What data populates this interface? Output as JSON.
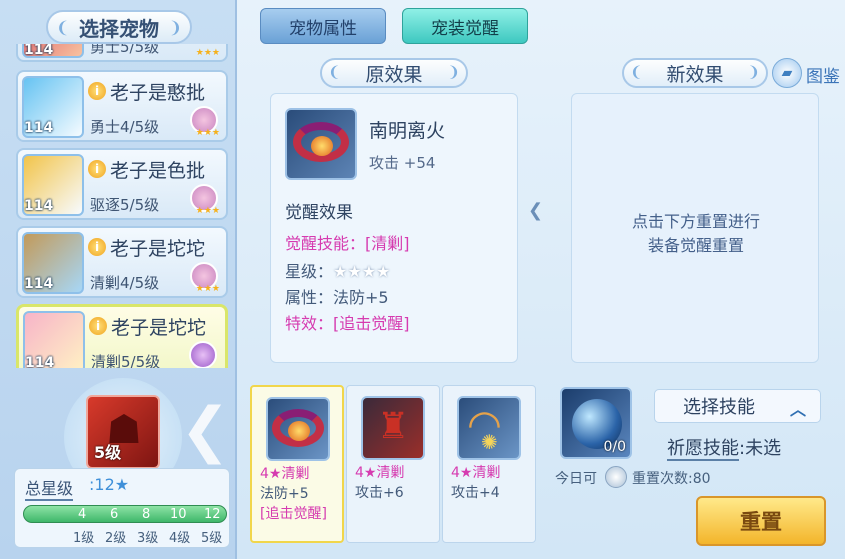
{
  "left": {
    "title": "选择宠物",
    "pets": [
      {
        "level": "114",
        "name": "",
        "rank": "勇士5/5级",
        "active": false
      },
      {
        "level": "114",
        "name": "老子是憨批",
        "rank": "勇士4/5级",
        "active": false
      },
      {
        "level": "114",
        "name": "老子是色批",
        "rank": "驱逐5/5级",
        "active": false
      },
      {
        "level": "114",
        "name": "老子是坨坨",
        "rank": "清剿4/5级",
        "active": false
      },
      {
        "level": "114",
        "name": "老子是坨坨",
        "rank": "清剿5/5级",
        "active": true
      }
    ],
    "skill_level": "5级",
    "total_star_label": "总星级",
    "total_star_value": ":12★",
    "star_ticks": [
      "4",
      "6",
      "8",
      "10",
      "12"
    ],
    "level_labels": [
      "1级",
      "2级",
      "3级",
      "4级",
      "5级"
    ]
  },
  "tabs": {
    "pet_attr": "宠物属性",
    "awaken": "宠装觉醒"
  },
  "old": {
    "header": "原效果",
    "item_name": "南明离火",
    "item_stat": "攻击 +54",
    "awaken_title": "觉醒效果",
    "skill_label": "觉醒技能：",
    "skill_value": "[清剿]",
    "star_label": "星级：",
    "star_value": "★★★★",
    "attr_label": "属性：",
    "attr_value": "法防+5",
    "effect_label": "特效：",
    "effect_value": "[追击觉醒]"
  },
  "new": {
    "header": "新效果",
    "atlas": "图鉴",
    "line1": "点击下方重置进行",
    "line2": "装备觉醒重置"
  },
  "equipment": [
    {
      "stars": "4★清剿",
      "stat": "法防+5",
      "extra": "[追击觉醒]",
      "active": true
    },
    {
      "stars": "4★清剿",
      "stat": "攻击+6",
      "extra": "",
      "active": false
    },
    {
      "stars": "4★清剿",
      "stat": "攻击+4",
      "extra": "",
      "active": false
    }
  ],
  "orb": {
    "count": "0/0"
  },
  "today_label": "今日可",
  "reset_count": "重置次数:80",
  "choose_skill": "选择技能",
  "wish_label": "祈愿技能",
  "wish_value": ":未选",
  "reset_button": "重置"
}
